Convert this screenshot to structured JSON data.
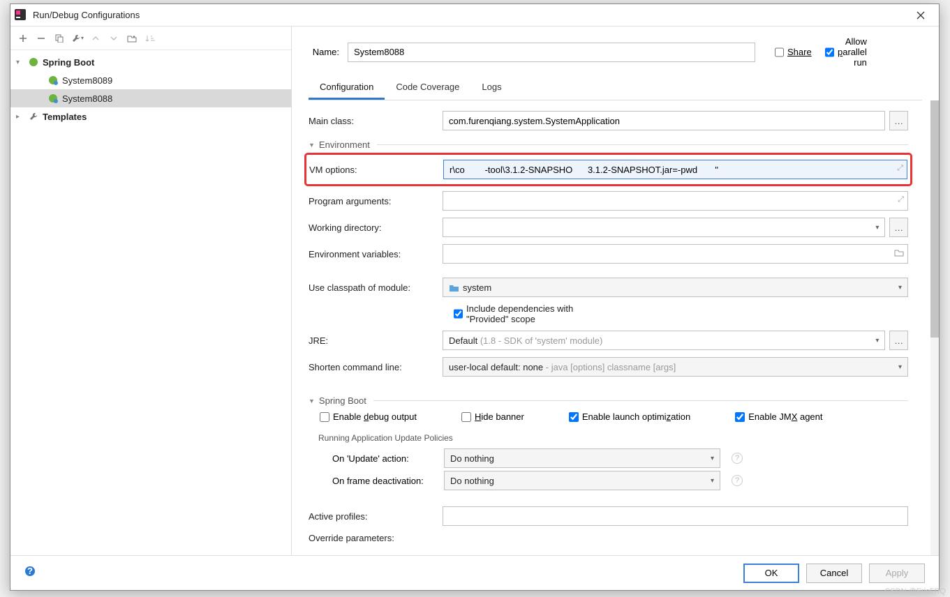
{
  "window": {
    "title": "Run/Debug Configurations"
  },
  "header": {
    "name_label": "Name:",
    "name_value": "System8088",
    "share": "Share",
    "allow_parallel": "Allow parallel run"
  },
  "tabs": {
    "config": "Configuration",
    "coverage": "Code Coverage",
    "logs": "Logs"
  },
  "tree": {
    "spring_boot": "Spring Boot",
    "items": [
      {
        "label": "System8089"
      },
      {
        "label": "System8088"
      }
    ],
    "templates": "Templates"
  },
  "form": {
    "main_class_label": "Main class:",
    "main_class_value": "com.furenqiang.system.SystemApplication",
    "env_section": "Environment",
    "vm_label": "VM options:",
    "vm_value": "r\\co        -tool\\3.1.2-SNAPSHO      3.1.2-SNAPSHOT.jar=-pwd       \"",
    "prog_args_label": "Program arguments:",
    "workdir_label": "Working directory:",
    "envvars_label": "Environment variables:",
    "classpath_label": "Use classpath of module:",
    "classpath_value": "system",
    "include_provided": "Include dependencies with \"Provided\" scope",
    "jre_label": "JRE:",
    "jre_prefix": "Default ",
    "jre_detail": "(1.8 - SDK of 'system' module)",
    "shorten_label": "Shorten command line:",
    "shorten_prefix": "user-local default: none ",
    "shorten_detail": "- java [options] classname [args]",
    "spring_section": "Spring Boot",
    "enable_debug": "Enable debug output",
    "hide_banner": "Hide banner",
    "enable_launch": "Enable launch optimization",
    "enable_jmx": "Enable JMX agent",
    "update_policies": "Running Application Update Policies",
    "on_update_label": "On 'Update' action:",
    "on_update_value": "Do nothing",
    "on_frame_label": "On frame deactivation:",
    "on_frame_value": "Do nothing",
    "active_profiles_label": "Active profiles:",
    "override_label": "Override parameters:"
  },
  "footer": {
    "ok": "OK",
    "cancel": "Cancel",
    "apply": "Apply"
  },
  "watermark": "CSDN @EricFRQ"
}
